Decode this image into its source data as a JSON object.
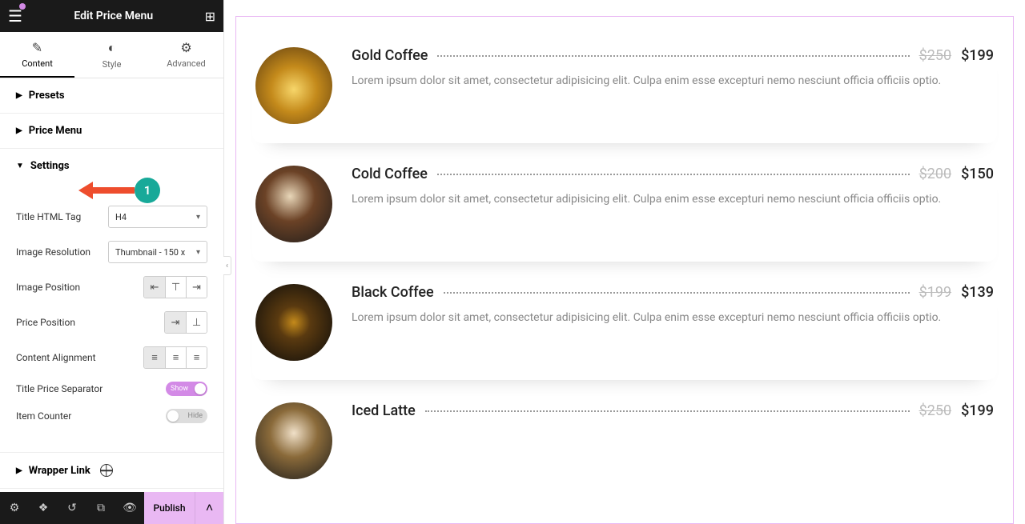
{
  "header": {
    "title": "Edit Price Menu"
  },
  "tabs": {
    "content": "Content",
    "style": "Style",
    "advanced": "Advanced"
  },
  "sections": {
    "presets": "Presets",
    "price_menu": "Price Menu",
    "settings": "Settings",
    "wrapper_link": "Wrapper Link"
  },
  "settings": {
    "title_tag_label": "Title HTML Tag",
    "title_tag_value": "H4",
    "image_res_label": "Image Resolution",
    "image_res_value": "Thumbnail - 150 x",
    "image_pos_label": "Image Position",
    "price_pos_label": "Price Position",
    "content_align_label": "Content Alignment",
    "separator_label": "Title Price Separator",
    "separator_state": "Show",
    "counter_label": "Item Counter",
    "counter_state": "Hide"
  },
  "footer": {
    "publish": "Publish"
  },
  "annotation": {
    "number": "1"
  },
  "menu": [
    {
      "title": "Gold Coffee",
      "old": "$250",
      "new": "$199",
      "desc": "Lorem ipsum dolor sit amet, consectetur adipisicing elit. Culpa enim esse excepturi nemo nesciunt officia officiis optio."
    },
    {
      "title": "Cold Coffee",
      "old": "$200",
      "new": "$150",
      "desc": "Lorem ipsum dolor sit amet, consectetur adipisicing elit. Culpa enim esse excepturi nemo nesciunt officia officiis optio."
    },
    {
      "title": "Black Coffee",
      "old": "$199",
      "new": "$139",
      "desc": "Lorem ipsum dolor sit amet, consectetur adipisicing elit. Culpa enim esse excepturi nemo nesciunt officia officiis optio."
    },
    {
      "title": "Iced Latte",
      "old": "$250",
      "new": "$199",
      "desc": ""
    }
  ]
}
